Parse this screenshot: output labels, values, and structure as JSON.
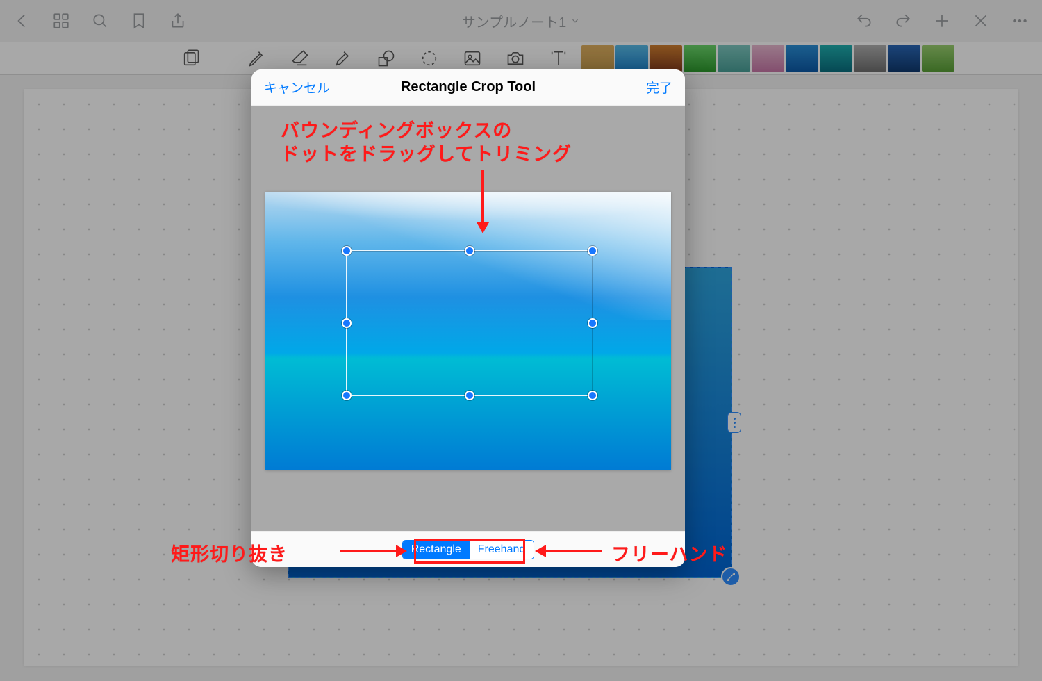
{
  "header": {
    "title": "サンプルノート1"
  },
  "modal": {
    "cancel": "キャンセル",
    "title": "Rectangle Crop Tool",
    "done": "完了",
    "segment": {
      "rectangle": "Rectangle",
      "freehand": "Freehand"
    }
  },
  "annotations": {
    "top_line1": "バウンディングボックスの",
    "top_line2": "ドットをドラッグしてトリミング",
    "bottom_left": "矩形切り抜き",
    "bottom_right": "フリーハンド"
  },
  "thumbs": [
    "linear-gradient(180deg,#e0b060,#caa050)",
    "linear-gradient(180deg,#5abce8,#1e88d6)",
    "linear-gradient(180deg,#d08030,#8a3e1e)",
    "linear-gradient(180deg,#6bd66b,#2e9a2e)",
    "linear-gradient(180deg,#7ec8c0,#4aa098)",
    "linear-gradient(180deg,#e8b8d0,#c878a8)",
    "linear-gradient(180deg,#2a90d8,#0d5aa8)",
    "linear-gradient(180deg,#1fb0b0,#0a7080)",
    "linear-gradient(180deg,#b0b0b0,#707070)",
    "linear-gradient(180deg,#2a68b8,#103a70)",
    "linear-gradient(180deg,#9ad070,#5aa038)"
  ]
}
